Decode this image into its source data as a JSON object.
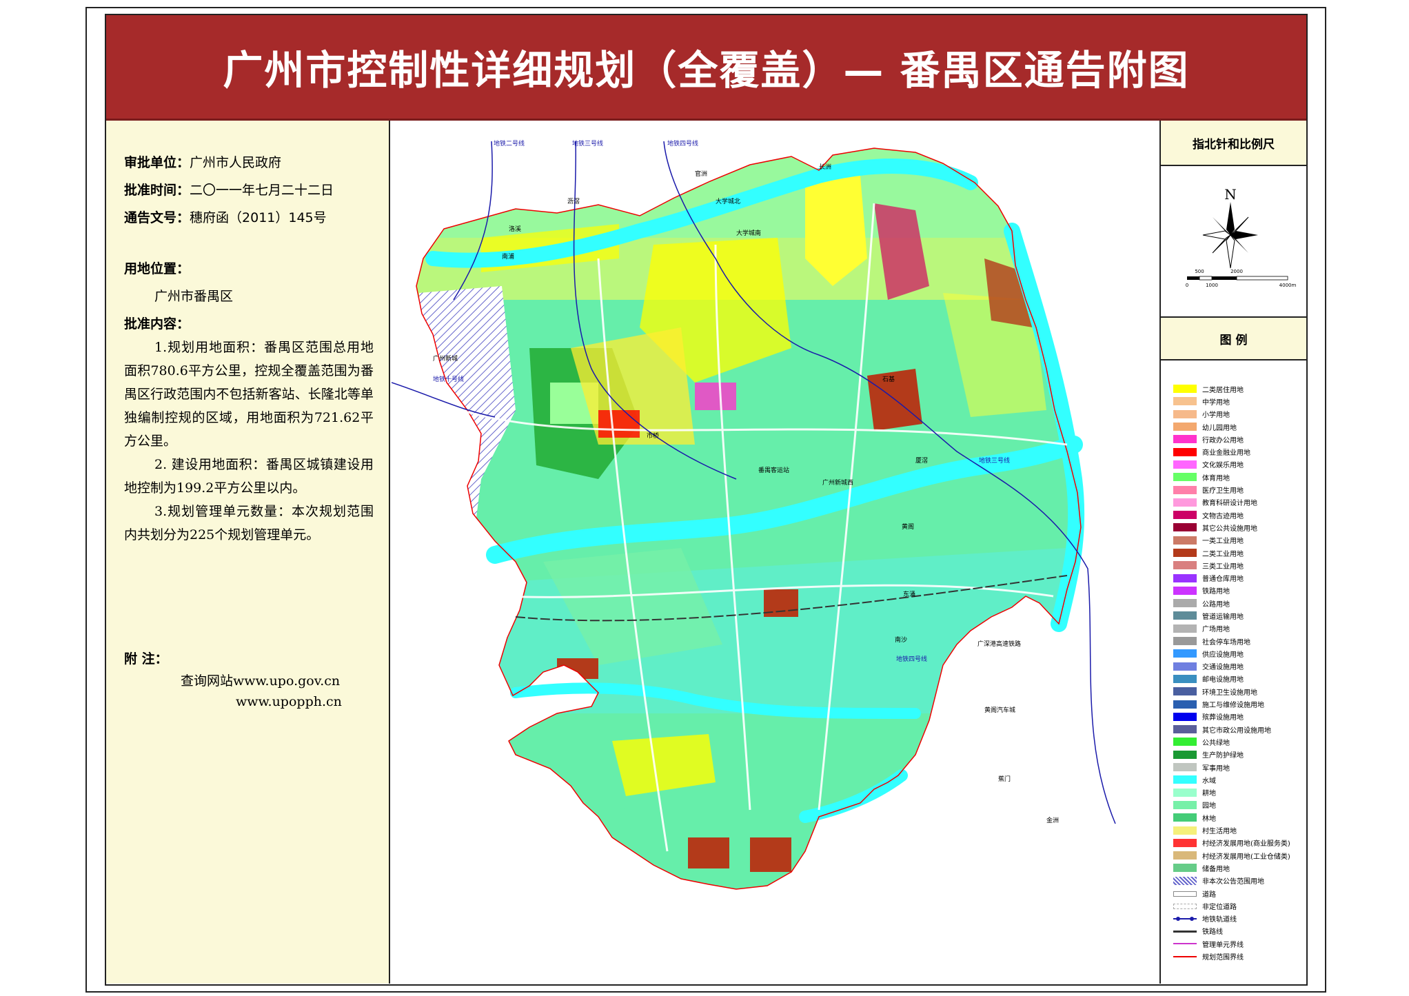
{
  "title": "广州市控制性详细规划（全覆盖）— 番禺区通告附图",
  "info": {
    "approver_label": "审批单位：",
    "approver_value": "广州市人民政府",
    "date_label": "批准时间：",
    "date_value": "二〇一一年七月二十二日",
    "doc_label": "通告文号：",
    "doc_value": "穗府函（2011）145号",
    "location_label": "用地位置：",
    "location_value": "广州市番禺区",
    "content_label": "批准内容：",
    "content_1": "1.规划用地面积：番禺区范围总用地面积780.6平方公里，控规全覆盖范围为番禺区行政范围内不包括新客站、长隆北等单独编制控规的区域，用地面积为721.62平方公里。",
    "content_2": "2. 建设用地面积：番禺区城镇建设用地控制为199.2平方公里以内。",
    "content_3": "3.规划管理单元数量：本次规划范围内共划分为225个规划管理单元。",
    "note_label": "附    注：",
    "note_line1": "查询网站www.upo.gov.cn",
    "note_line2": "www.upopph.cn"
  },
  "compass": {
    "header": "指北针和比例尺",
    "north": "N",
    "scale_top": [
      "500",
      "2000"
    ],
    "scale_bottom": [
      "0",
      "1000",
      "4000m"
    ]
  },
  "legend": {
    "header": "图  例",
    "items": [
      {
        "label": "二类居住用地",
        "color": "#ffff00",
        "kind": "fill"
      },
      {
        "label": "中学用地",
        "color": "#f7c28e",
        "kind": "fill"
      },
      {
        "label": "小学用地",
        "color": "#f6b98a",
        "kind": "fill"
      },
      {
        "label": "幼儿园用地",
        "color": "#f3a86e",
        "kind": "fill"
      },
      {
        "label": "行政办公用地",
        "color": "#ff33cc",
        "kind": "fill"
      },
      {
        "label": "商业金融业用地",
        "color": "#ff0000",
        "kind": "fill"
      },
      {
        "label": "文化娱乐用地",
        "color": "#ff66ff",
        "kind": "fill"
      },
      {
        "label": "体育用地",
        "color": "#66ff66",
        "kind": "fill"
      },
      {
        "label": "医疗卫生用地",
        "color": "#ff7faa",
        "kind": "fill"
      },
      {
        "label": "教育科研设计用地",
        "color": "#ff99dd",
        "kind": "fill"
      },
      {
        "label": "文物古迹用地",
        "color": "#cc0066",
        "kind": "fill"
      },
      {
        "label": "其它公共设施用地",
        "color": "#990033",
        "kind": "fill"
      },
      {
        "label": "一类工业用地",
        "color": "#cc7a66",
        "kind": "fill"
      },
      {
        "label": "二类工业用地",
        "color": "#b33a1a",
        "kind": "fill"
      },
      {
        "label": "三类工业用地",
        "color": "#d98080",
        "kind": "fill"
      },
      {
        "label": "普通仓库用地",
        "color": "#9933ff",
        "kind": "fill"
      },
      {
        "label": "铁路用地",
        "color": "#cc33ff",
        "kind": "fill"
      },
      {
        "label": "公路用地",
        "color": "#aaaaaa",
        "kind": "fill"
      },
      {
        "label": "管道运输用地",
        "color": "#5e8c99",
        "kind": "fill"
      },
      {
        "label": "广场用地",
        "color": "#b3b3b3",
        "kind": "fill"
      },
      {
        "label": "社会停车场用地",
        "color": "#999999",
        "kind": "fill"
      },
      {
        "label": "供应设施用地",
        "color": "#3399ff",
        "kind": "fill"
      },
      {
        "label": "交通设施用地",
        "color": "#6f7fe0",
        "kind": "fill"
      },
      {
        "label": "邮电设施用地",
        "color": "#3a8fc0",
        "kind": "fill"
      },
      {
        "label": "环境卫生设施用地",
        "color": "#4a5fa0",
        "kind": "fill"
      },
      {
        "label": "施工与维修设施用地",
        "color": "#2a5fb0",
        "kind": "fill"
      },
      {
        "label": "殡葬设施用地",
        "color": "#0000ee",
        "kind": "fill"
      },
      {
        "label": "其它市政公用设施用地",
        "color": "#5a5f9a",
        "kind": "fill"
      },
      {
        "label": "公共绿地",
        "color": "#33ee33",
        "kind": "fill"
      },
      {
        "label": "生产防护绿地",
        "color": "#1a9933",
        "kind": "fill"
      },
      {
        "label": "军事用地",
        "color": "#c0c6c0",
        "kind": "fill"
      },
      {
        "label": "水域",
        "color": "#33ffff",
        "kind": "fill"
      },
      {
        "label": "耕地",
        "color": "#99ffcc",
        "kind": "fill"
      },
      {
        "label": "园地",
        "color": "#77f0a8",
        "kind": "fill"
      },
      {
        "label": "林地",
        "color": "#44cc77",
        "kind": "fill"
      },
      {
        "label": "村生活用地",
        "color": "#f5f07a",
        "kind": "fill"
      },
      {
        "label": "村经济发展用地(商业服务类)",
        "color": "#ff3333",
        "kind": "fill"
      },
      {
        "label": "村经济发展用地(工业仓储类)",
        "color": "#d9b87a",
        "kind": "fill"
      },
      {
        "label": "储备用地",
        "color": "#66cc88",
        "kind": "fill"
      },
      {
        "label": "非本次公告范围用地",
        "color": "#6666cc",
        "kind": "hatch"
      },
      {
        "label": "道路",
        "color": "#888888",
        "kind": "road"
      },
      {
        "label": "非定位道路",
        "color": "#aaaaaa",
        "kind": "road2"
      },
      {
        "label": "地铁轨道线",
        "color": "#1a1aaa",
        "kind": "metro"
      },
      {
        "label": "铁路线",
        "color": "#333333",
        "kind": "rail"
      },
      {
        "label": "管理单元界线",
        "color": "#cc33cc",
        "kind": "line"
      },
      {
        "label": "规划范围界线",
        "color": "#ee0000",
        "kind": "line"
      }
    ]
  },
  "map": {
    "metro_labels": [
      "地铁二号线",
      "地铁三号线",
      "地铁四号线",
      "地铁三号线",
      "地铁四号线",
      "地铁十号线"
    ],
    "place_labels": [
      "长洲",
      "官洲",
      "大学城北",
      "大学城南",
      "沥滘",
      "洛溪",
      "南浦",
      "广州新城",
      "广州新城西",
      "市桥",
      "番禺客运站",
      "东涌",
      "石基",
      "厦滘",
      "黄阁",
      "南沙",
      "广深港高速铁路",
      "黄阁汽车城",
      "金洲",
      "蕉门"
    ]
  }
}
